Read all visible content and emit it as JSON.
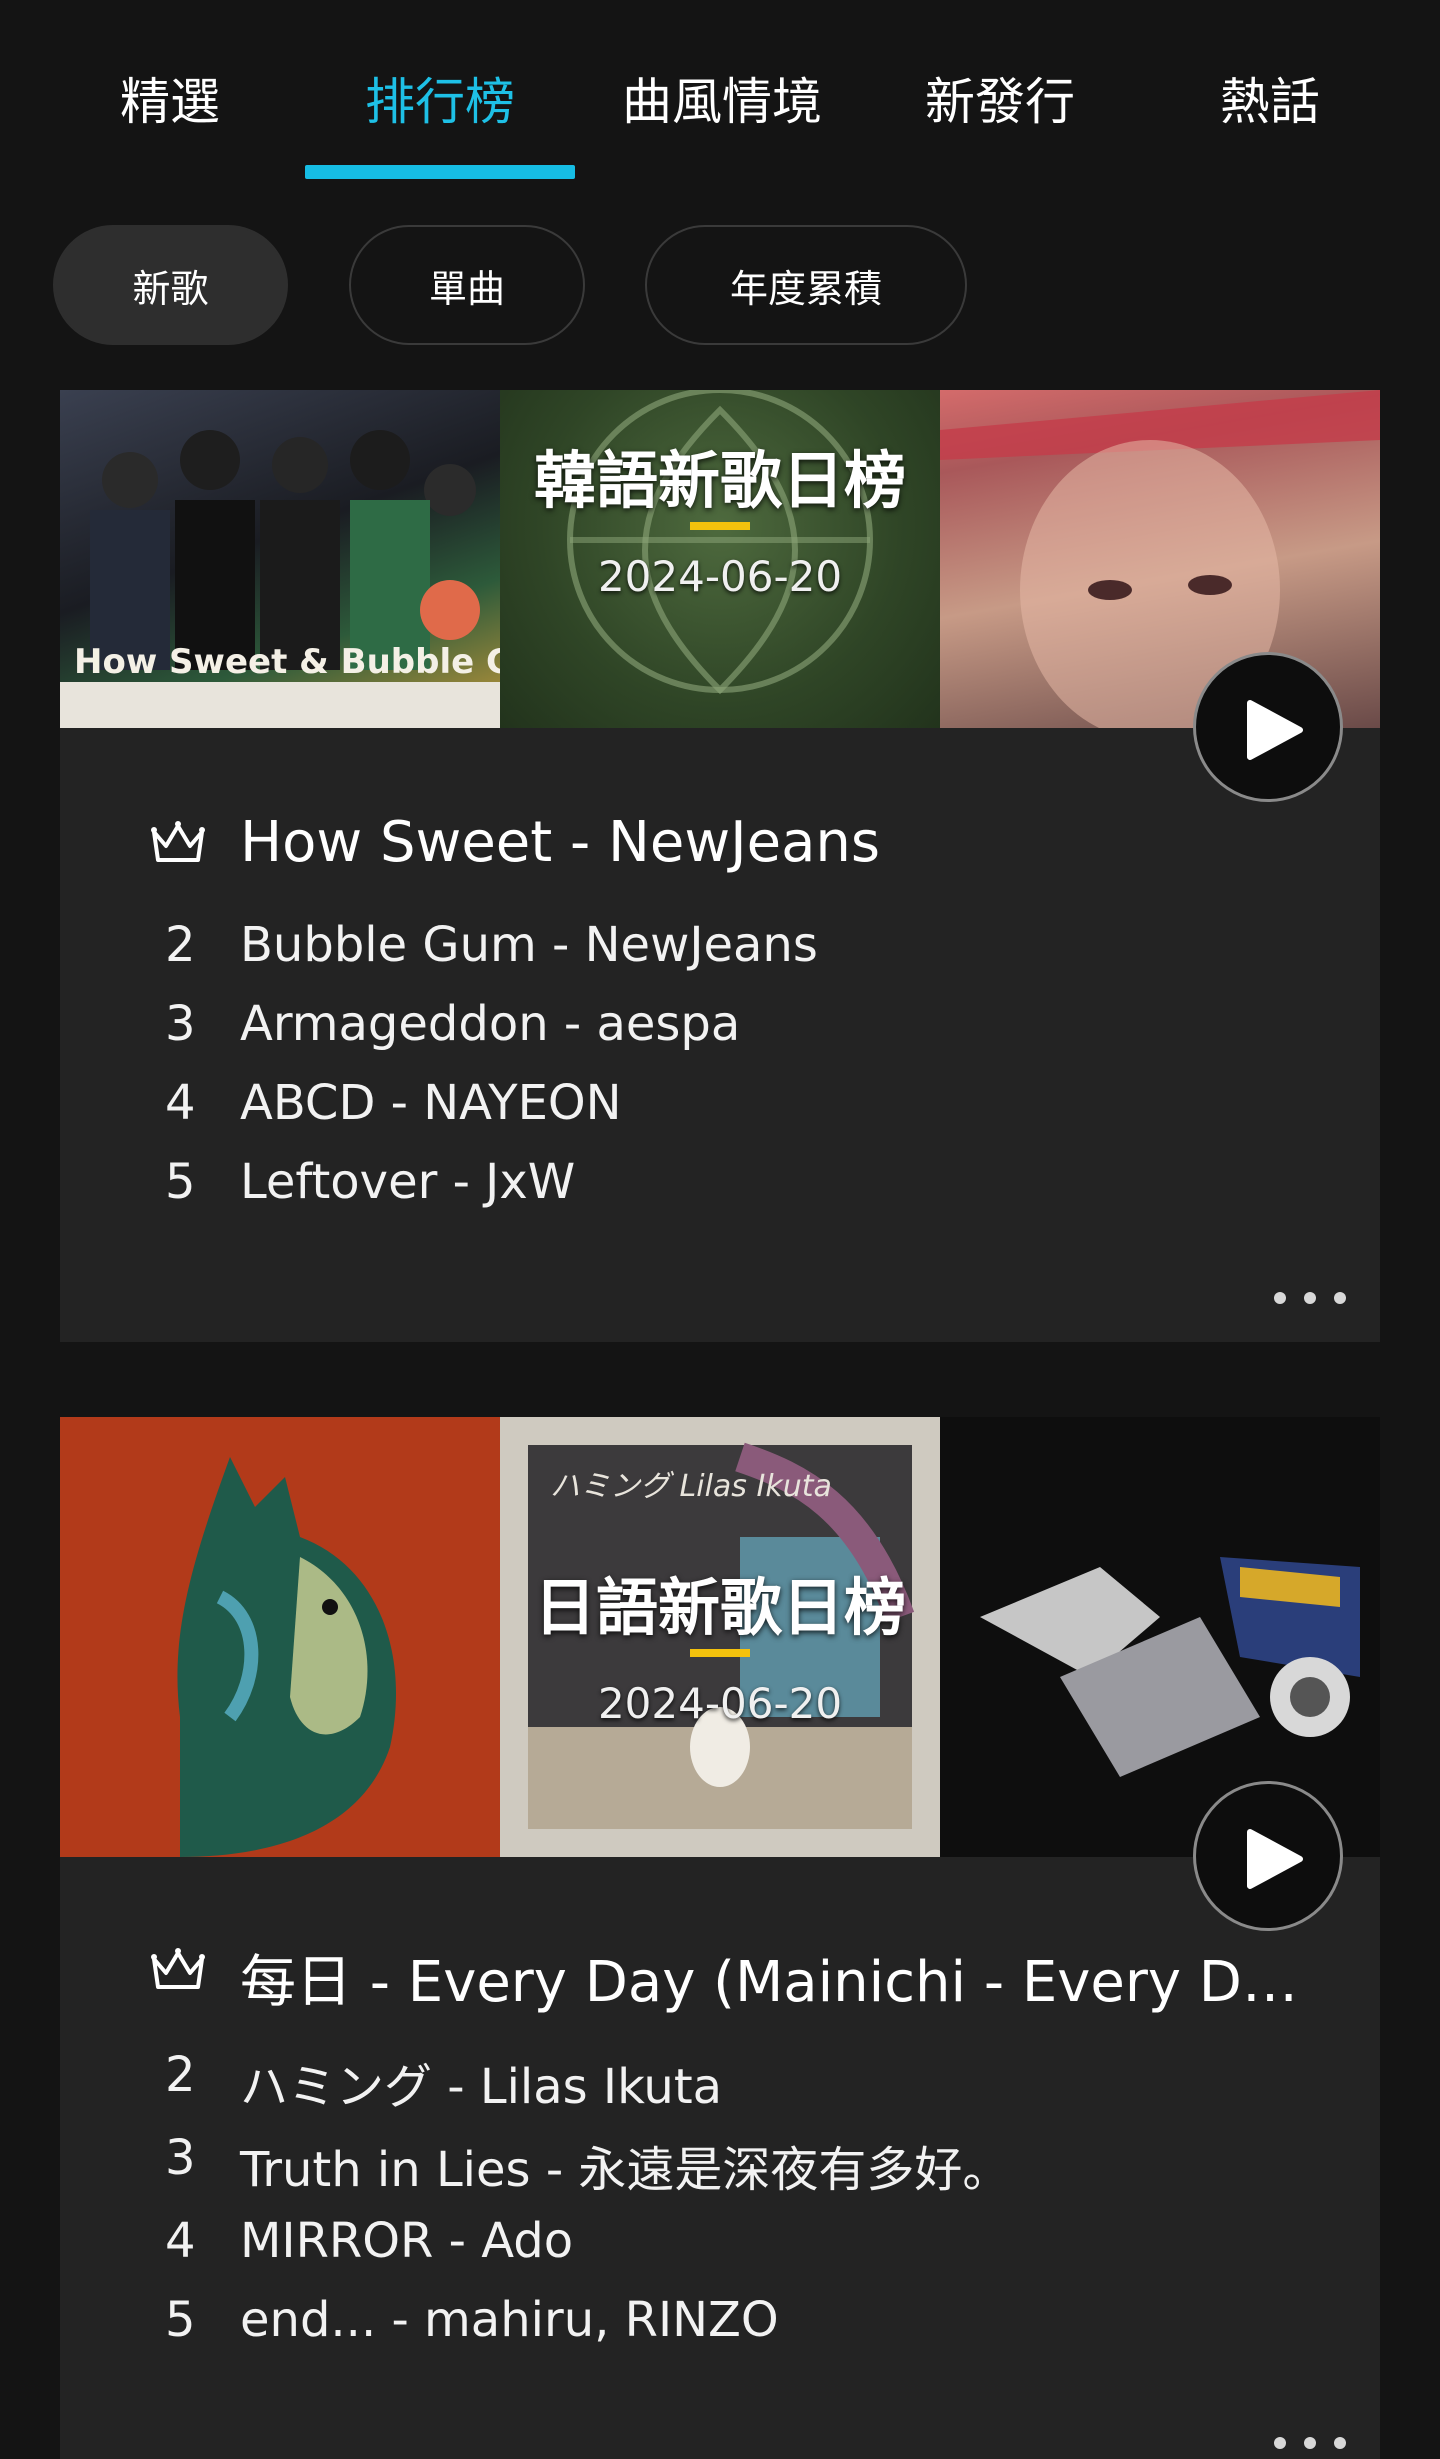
{
  "tabs": [
    "精選",
    "排行榜",
    "曲風情境",
    "新發行",
    "熱話"
  ],
  "active_tab": "排行榜",
  "pills": [
    "新歌",
    "單曲",
    "年度累積"
  ],
  "active_pill": "新歌",
  "cards": [
    {
      "title": "韓語新歌日榜",
      "date": "2024-06-20",
      "top": "How Sweet - NewJeans",
      "rows": [
        {
          "rank": "2",
          "song": "Bubble Gum - NewJeans"
        },
        {
          "rank": "3",
          "song": "Armageddon - aespa"
        },
        {
          "rank": "4",
          "song": "ABCD - NAYEON"
        },
        {
          "rank": "5",
          "song": "Leftover - JxW"
        }
      ],
      "art_text": "How Sweet & Bubble Gum"
    },
    {
      "title": "日語新歌日榜",
      "date": "2024-06-20",
      "top": "每日 - Every Day (Mainichi - Every Day…",
      "rows": [
        {
          "rank": "2",
          "song": "ハミング - Lilas Ikuta"
        },
        {
          "rank": "3",
          "song": "Truth in Lies - 永遠是深夜有多好。"
        },
        {
          "rank": "4",
          "song": "MIRROR - Ado"
        },
        {
          "rank": "5",
          "song": "end... - mahiru, RINZO"
        }
      ],
      "art_text": "ハミング Lilas Ikuta"
    }
  ],
  "colors": {
    "accent": "#16bde4",
    "highlight": "#f4c20d",
    "card": "#232323",
    "bg": "#141414"
  }
}
